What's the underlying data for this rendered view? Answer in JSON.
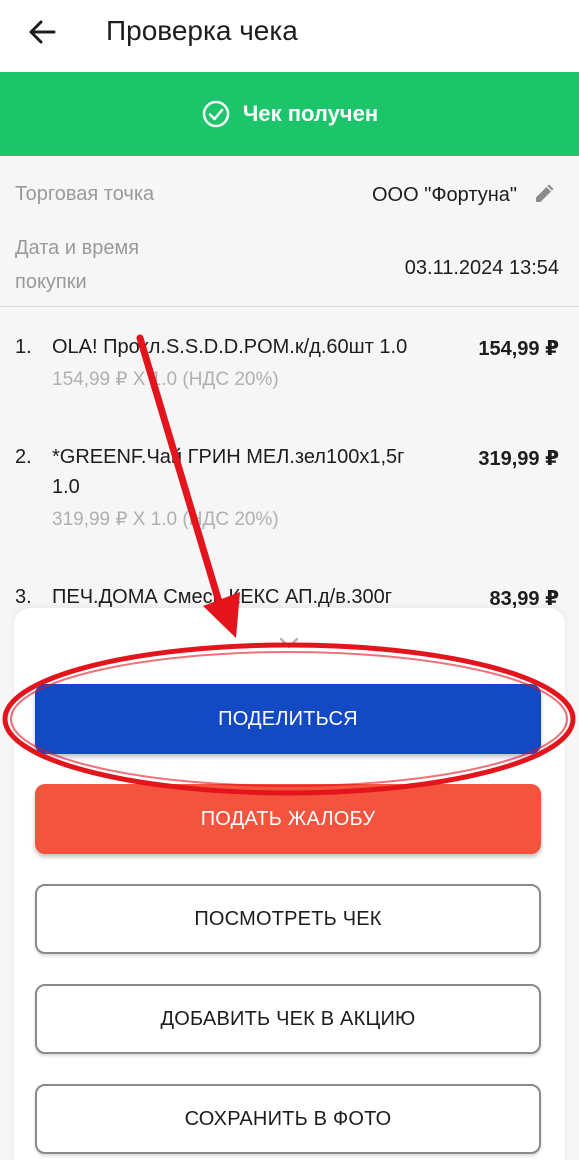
{
  "header": {
    "title": "Проверка чека"
  },
  "status": {
    "text": "Чек получен",
    "color": "#1cc46a"
  },
  "receipt": {
    "store_label": "Торговая точка",
    "store_value": "ООО \"Фортуна\"",
    "datetime_label_line1": "Дата и время",
    "datetime_label_line2": "покупки",
    "datetime_value": "03.11.2024 13:54"
  },
  "items": [
    {
      "num": "1.",
      "name": "OLA! Прокл.S.S.D.D.POM.к/д.60шт 1.0",
      "price": "154,99 ₽",
      "details": "154,99 ₽ X 1.0  (НДС 20%)"
    },
    {
      "num": "2.",
      "name": "*GREENF.Чай ГРИН МЕЛ.зел100x1,5г 1.0",
      "price": "319,99 ₽",
      "details": "319,99 ₽ X 1.0  (НДС 20%)"
    },
    {
      "num": "3.",
      "name": "ПЕЧ.ДОМА Смесь КЕКС АП.д/в.300г",
      "price": "83,99 ₽",
      "details": ""
    }
  ],
  "actions": {
    "share": "ПОДЕЛИТЬСЯ",
    "complaint": "ПОДАТЬ ЖАЛОБУ",
    "view": "ПОСМОТРЕТЬ ЧЕК",
    "promo": "ДОБАВИТЬ ЧЕК В АКЦИЮ",
    "save": "СОХРАНИТЬ В ФОТО"
  },
  "colors": {
    "share_button": "#1449c4",
    "complaint_button": "#f4533e",
    "annotation": "#e3141c"
  },
  "icons": {
    "back": "back-arrow-icon",
    "status": "check-circle-icon",
    "edit": "pencil-icon",
    "collapse": "chevron-down-icon"
  }
}
